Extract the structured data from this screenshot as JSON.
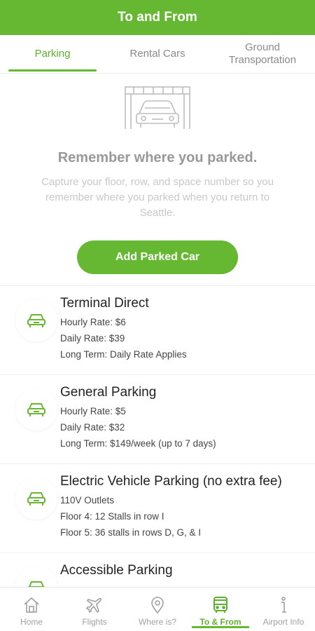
{
  "header": {
    "title": "To and From"
  },
  "tabs": [
    {
      "label": "Parking",
      "active": true
    },
    {
      "label": "Rental Cars",
      "active": false
    },
    {
      "label": "Ground Transportation",
      "active": false
    }
  ],
  "empty_state": {
    "title": "Remember where you parked.",
    "description": "Capture your floor, row, and space number so you remember where you parked when you return to Seattle.",
    "button_label": "Add Parked Car"
  },
  "parking_options": [
    {
      "title": "Terminal Direct",
      "lines": [
        "Hourly Rate: $6",
        "Daily Rate: $39",
        "Long Term: Daily Rate Applies"
      ]
    },
    {
      "title": "General Parking",
      "lines": [
        "Hourly Rate: $5",
        "Daily Rate: $32",
        "Long Term: $149/week (up to 7 days)"
      ]
    },
    {
      "title": "Electric Vehicle Parking (no extra fee)",
      "lines": [
        "110V Outlets",
        "Floor 4: 12 Stalls in row I",
        "Floor 5: 36 stalls in rows D, G, & I"
      ]
    },
    {
      "title": "Accessible Parking",
      "lines": []
    }
  ],
  "bottom_nav": [
    {
      "label": "Home",
      "icon": "home-icon",
      "active": false
    },
    {
      "label": "Flights",
      "icon": "plane-icon",
      "active": false
    },
    {
      "label": "Where is?",
      "icon": "location-pin-icon",
      "active": false
    },
    {
      "label": "To & From",
      "icon": "bus-icon",
      "active": true
    },
    {
      "label": "Airport Info",
      "icon": "info-icon",
      "active": false
    }
  ],
  "colors": {
    "accent": "#66b832",
    "muted_text": "#999999",
    "inactive_nav": "#a0a0a0"
  }
}
